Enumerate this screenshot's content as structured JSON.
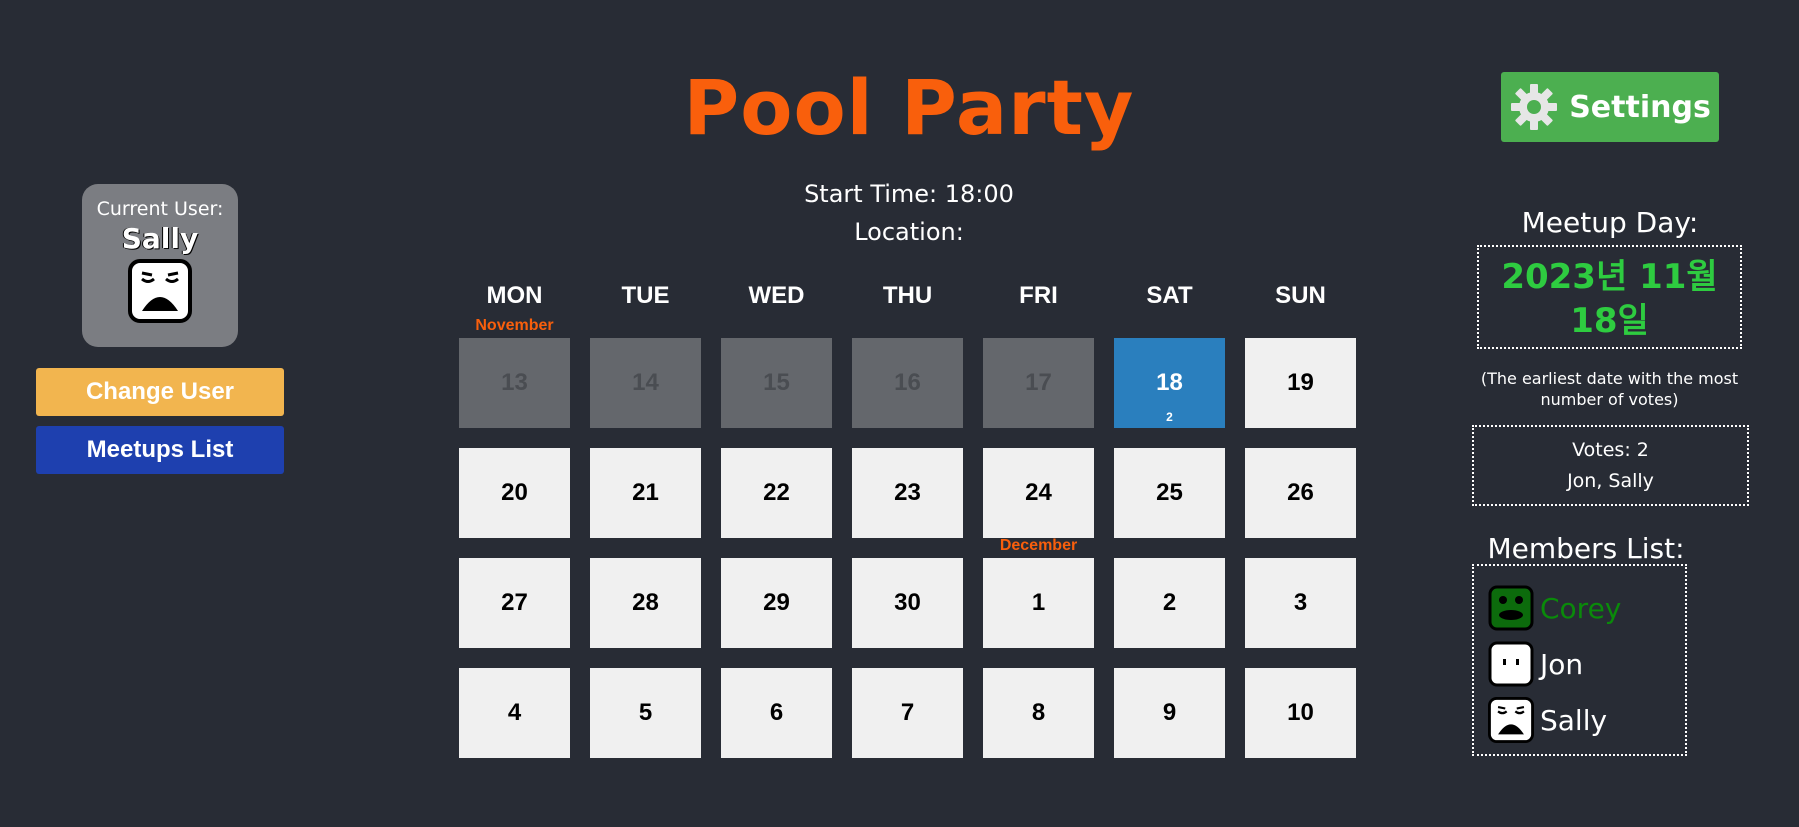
{
  "header": {
    "title": "Pool Party",
    "settings_label": "Settings"
  },
  "event": {
    "start_time": "Start Time: 18:00",
    "location": "Location:"
  },
  "current_user": {
    "label": "Current User:",
    "name": "Sally"
  },
  "buttons": {
    "change_user": "Change User",
    "meetups_list": "Meetups List"
  },
  "calendar": {
    "days_of_week": [
      "MON",
      "TUE",
      "WED",
      "THU",
      "FRI",
      "SAT",
      "SUN"
    ],
    "month_labels": [
      {
        "text": "November",
        "row": 0,
        "col": 0
      },
      {
        "text": "December",
        "row": 2,
        "col": 4
      }
    ],
    "weeks": [
      [
        "13",
        "14",
        "15",
        "16",
        "17",
        "18",
        "19"
      ],
      [
        "20",
        "21",
        "22",
        "23",
        "24",
        "25",
        "26"
      ],
      [
        "27",
        "28",
        "29",
        "30",
        "1",
        "2",
        "3"
      ],
      [
        "4",
        "5",
        "6",
        "7",
        "8",
        "9",
        "10"
      ]
    ],
    "past_days": [
      "13",
      "14",
      "15",
      "16",
      "17"
    ],
    "selected_day": "18",
    "selected_votes": "2"
  },
  "meetup": {
    "heading": "Meetup Day:",
    "date": "2023년 11월 18일",
    "note": "(The earliest date with the most number of votes)",
    "votes_label": "Votes: 2",
    "voters": "Jon, Sally"
  },
  "members": {
    "heading": "Members List:",
    "list": [
      {
        "name": "Corey",
        "face": "green-blob-face-icon",
        "leader": true
      },
      {
        "name": "Jon",
        "face": "neutral-face-icon",
        "leader": false
      },
      {
        "name": "Sally",
        "face": "sad-face-icon",
        "leader": false
      }
    ]
  },
  "colors": {
    "background": "#282c35",
    "accent": "#f95f0c",
    "selected": "#2a7fbe",
    "settings": "#4caf50",
    "change_user": "#f2b54f",
    "meetups": "#1e40af",
    "date_green": "#2ecc40"
  }
}
